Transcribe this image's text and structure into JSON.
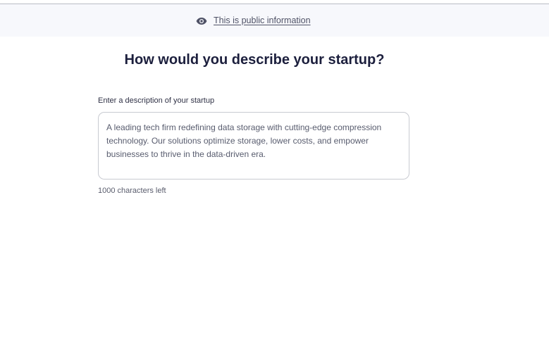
{
  "notice": {
    "icon": "eye-icon",
    "link_text": "This is public information"
  },
  "page": {
    "heading": "How would you describe your startup?"
  },
  "description_field": {
    "label": "Enter a description of your startup",
    "value": "A leading tech firm redefining data storage with cutting-edge compression\ntechnology. Our solutions optimize storage, lower costs, and empower\nbusinesses to thrive in the data-driven era.",
    "characters_left": "1000 characters left"
  },
  "colors": {
    "heading": "#1c1f3d",
    "notice_background": "#f7f8fc",
    "border": "#c8cad1"
  }
}
